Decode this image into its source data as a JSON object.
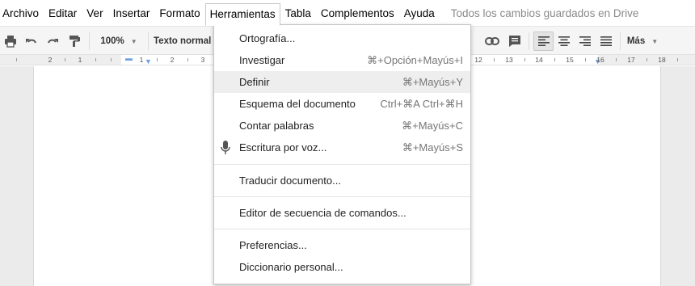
{
  "menubar": {
    "items": [
      {
        "label": "Archivo"
      },
      {
        "label": "Editar"
      },
      {
        "label": "Ver"
      },
      {
        "label": "Insertar"
      },
      {
        "label": "Formato"
      },
      {
        "label": "Herramientas"
      },
      {
        "label": "Tabla"
      },
      {
        "label": "Complementos"
      },
      {
        "label": "Ayuda"
      }
    ],
    "active_item": "Herramientas",
    "save_status": "Todos los cambios guardados en Drive"
  },
  "toolbar": {
    "zoom": "100%",
    "style": "Texto normal",
    "more_label": "Más",
    "icons": [
      "print-icon",
      "undo-icon",
      "redo-icon",
      "paint-format-icon",
      "link-icon",
      "comment-icon",
      "align-left-icon",
      "align-center-icon",
      "align-right-icon",
      "justify-icon"
    ],
    "active_alignment": "align-left"
  },
  "ruler": {
    "ticks": [
      "2",
      "1",
      "1",
      "2",
      "3",
      "12",
      "13",
      "14",
      "15",
      "16",
      "17",
      "18"
    ]
  },
  "tools_menu": {
    "items": [
      {
        "label": "Ortografía...",
        "shortcut": ""
      },
      {
        "label": "Investigar",
        "shortcut": "⌘+Opción+Mayús+I"
      },
      {
        "label": "Definir",
        "shortcut": "⌘+Mayús+Y"
      },
      {
        "label": "Esquema del documento",
        "shortcut": "Ctrl+⌘A Ctrl+⌘H"
      },
      {
        "label": "Contar palabras",
        "shortcut": "⌘+Mayús+C"
      },
      {
        "label": "Escritura por voz...",
        "shortcut": "⌘+Mayús+S",
        "icon": "microphone-icon"
      },
      {
        "label": "Traducir documento...",
        "shortcut": ""
      },
      {
        "label": "Editor de secuencia de comandos...",
        "shortcut": ""
      },
      {
        "label": "Preferencias...",
        "shortcut": ""
      },
      {
        "label": "Diccionario personal...",
        "shortcut": ""
      }
    ],
    "hovered_item": "Definir"
  }
}
